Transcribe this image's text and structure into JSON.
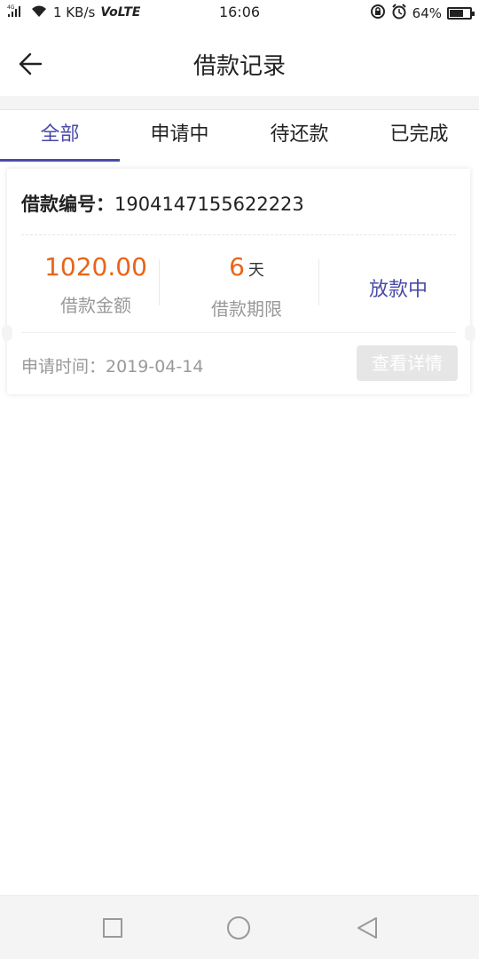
{
  "status_bar": {
    "network": "4G",
    "speed": "1 KB/s",
    "volte": "VoLTE",
    "time": "16:06",
    "battery": "64%",
    "battery_level": 0.64
  },
  "header": {
    "title": "借款记录"
  },
  "tabs": [
    {
      "label": "全部",
      "active": true
    },
    {
      "label": "申请中",
      "active": false
    },
    {
      "label": "待还款",
      "active": false
    },
    {
      "label": "已完成",
      "active": false
    }
  ],
  "card": {
    "id_label": "借款编号：",
    "id_value": "1904147155622223",
    "amount_value": "1020.00",
    "amount_label": "借款金额",
    "term_value": "6",
    "term_unit": "天",
    "term_label": "借款期限",
    "status": "放款中",
    "apply_time": "申请时间：2019-04-14",
    "detail_button": "查看详情"
  },
  "colors": {
    "accent": "#4a4aa8",
    "amount": "#e8641a"
  }
}
